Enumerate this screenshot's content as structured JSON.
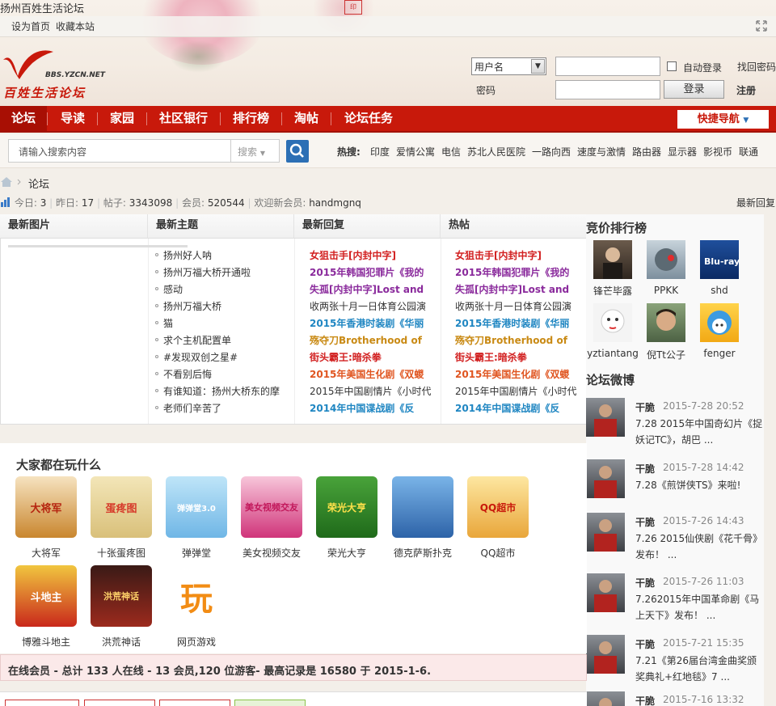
{
  "site": {
    "title": "扬州百姓生活论坛",
    "seal": "印"
  },
  "topbar": {
    "set_home": "设为首页",
    "bookmark": "收藏本站"
  },
  "logo": {
    "url": "BBS.YZCN.NET",
    "text": "百姓生活论坛"
  },
  "login": {
    "user_select": "用户名",
    "auto_login": "自动登录",
    "forgot": "找回密码",
    "password_label": "密码",
    "login_button": "登录",
    "register": "注册"
  },
  "nav": {
    "items": [
      "论坛",
      "导读",
      "家园",
      "社区银行",
      "排行榜",
      "淘帖",
      "论坛任务"
    ],
    "quick": "快捷导航"
  },
  "search": {
    "placeholder": "请输入搜索内容",
    "type": "搜索",
    "hot_label": "热搜:",
    "hot": [
      "印度",
      "爱情公寓",
      "电信",
      "苏北人民医院",
      "一路向西",
      "速度与激情",
      "路由器",
      "显示器",
      "影视币",
      "联通"
    ]
  },
  "breadcrumb": {
    "current": "论坛"
  },
  "stats": {
    "today_label": "今日:",
    "today": "3",
    "yesterday_label": "昨日:",
    "yesterday": "17",
    "posts_label": "帖子:",
    "posts": "3343098",
    "members_label": "会员:",
    "members": "520544",
    "welcome_label": "欢迎新会员:",
    "newest": "handmgnq",
    "latest_reply": "最新回复"
  },
  "panel": {
    "headers": [
      "最新图片",
      "最新主题",
      "最新回复",
      "热帖"
    ],
    "topics": [
      "扬州好人呐",
      "扬州万福大桥开通啦",
      "感动",
      "扬州万福大桥",
      "猫",
      "求个主机配置单",
      "#发现双创之星#",
      "不看别后悔",
      "有谁知道：扬州大桥东的摩",
      "老师们辛苦了"
    ],
    "replies": [
      {
        "text": "女狙击手[内封中字]",
        "color": "#d22020"
      },
      {
        "text": "2015年韩国犯罪片《我的",
        "color": "#8a2a9c"
      },
      {
        "text": "失孤[内封中字]Lost and",
        "color": "#8a2a9c"
      },
      {
        "text": "收两张十月一日体育公园演",
        "color": "#333333"
      },
      {
        "text": "2015年香港时装剧《华丽",
        "color": "#1f86c2"
      },
      {
        "text": "殇夺刀Brotherhood of",
        "color": "#c98a14"
      },
      {
        "text": "街头霸王:暗杀拳",
        "color": "#d22020"
      },
      {
        "text": "2015年美国生化剧《双蝬",
        "color": "#e05520"
      },
      {
        "text": "2015年中国剧情片《小时代",
        "color": "#333333"
      },
      {
        "text": "2014年中国谍战剧《反",
        "color": "#1f86c2"
      }
    ],
    "hot": [
      {
        "text": "女狙击手[内封中字]",
        "color": "#d22020"
      },
      {
        "text": "2015年韩国犯罪片《我的",
        "color": "#8a2a9c"
      },
      {
        "text": "失孤[内封中字]Lost and",
        "color": "#8a2a9c"
      },
      {
        "text": "收两张十月一日体育公园演",
        "color": "#333333"
      },
      {
        "text": "2015年香港时装剧《华丽",
        "color": "#1f86c2"
      },
      {
        "text": "殇夺刀Brotherhood of",
        "color": "#c98a14"
      },
      {
        "text": "街头霸王:暗杀拳",
        "color": "#d22020"
      },
      {
        "text": "2015年美国生化剧《双蝬",
        "color": "#e05520"
      },
      {
        "text": "2015年中国剧情片《小时代",
        "color": "#333333"
      },
      {
        "text": "2014年中国谍战剧《反",
        "color": "#1f86c2"
      }
    ]
  },
  "ranking": {
    "title": "竞价排行榜",
    "users": [
      "锋芒毕露",
      "PPKK",
      "shd",
      "yztiantang",
      "倪Tt公子",
      "fenger"
    ]
  },
  "weibo": {
    "title": "论坛微博",
    "posts": [
      {
        "user": "干脆",
        "time": "2015-7-28 20:52",
        "text": "7.28 2015年中国奇幻片《捉妖记TC》，胡巴 ..."
      },
      {
        "user": "干脆",
        "time": "2015-7-28 14:42",
        "text": "7.28《煎饼侠TS》来啦!"
      },
      {
        "user": "干脆",
        "time": "2015-7-26 14:43",
        "text": "7.26 2015仙侠剧《花千骨》发布！ ..."
      },
      {
        "user": "干脆",
        "time": "2015-7-26 11:03",
        "text": "7.262015年中国革命剧《马上天下》发布！ ..."
      },
      {
        "user": "干脆",
        "time": "2015-7-21 15:35",
        "text": "7.21《第26届台湾金曲奖颁奖典礼+红地毯》7 ..."
      },
      {
        "user": "干脆",
        "time": "2015-7-16 13:32",
        "text": ""
      }
    ]
  },
  "games": {
    "title": "大家都在玩什么",
    "items": [
      "大将军",
      "十张蛋疼图",
      "弹弹堂",
      "美女视频交友",
      "荣光大亨",
      "德克萨斯扑克",
      "QQ超市",
      "博雅斗地主",
      "洪荒神话",
      "网页游戏"
    ],
    "labels": [
      "大将军",
      "蛋疼图",
      "弹弹堂3.0",
      "美女视频交友",
      "荣光大亨",
      "",
      "QQ超市",
      "斗地主",
      "洪荒神话",
      "玩"
    ]
  },
  "online": {
    "text": "在线会员 - 总计  133 人在线  - 13 会员,120 位游客- 最高记录是  16580 于  2015-1-6."
  }
}
